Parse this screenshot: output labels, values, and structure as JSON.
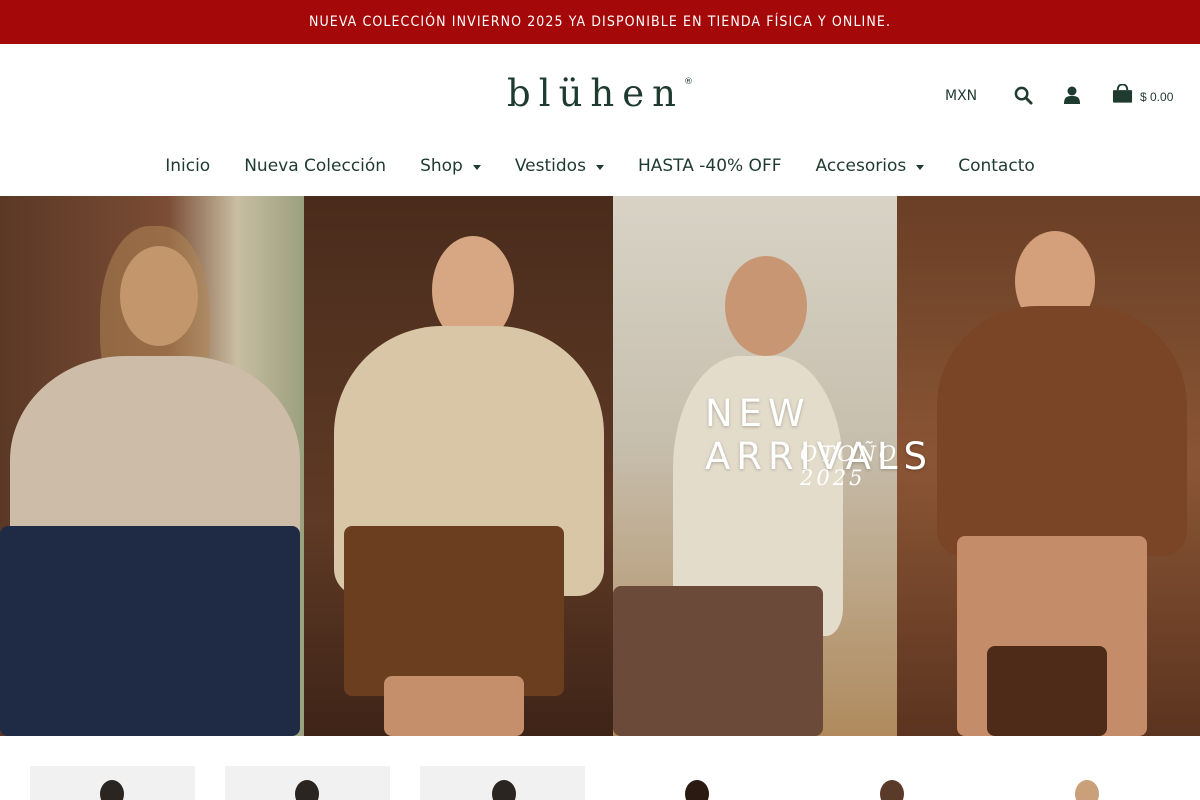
{
  "announcement": "NUEVA COLECCIÓN INVIERNO 2025 YA DISPONIBLE EN TIENDA FÍSICA Y ONLINE.",
  "brand": {
    "name": "blühen",
    "registered_mark": "®"
  },
  "header": {
    "currency": "MXN",
    "cart_total": "$ 0.00"
  },
  "nav": {
    "items": [
      {
        "label": "Inicio",
        "has_dropdown": false
      },
      {
        "label": "Nueva Colección",
        "has_dropdown": false
      },
      {
        "label": "Shop",
        "has_dropdown": true
      },
      {
        "label": "Vestidos",
        "has_dropdown": true
      },
      {
        "label": "HASTA -40% OFF",
        "has_dropdown": false
      },
      {
        "label": "Accesorios",
        "has_dropdown": true
      },
      {
        "label": "Contacto",
        "has_dropdown": false
      }
    ]
  },
  "hero": {
    "title": "NEW ARRIVALS",
    "subtitle": "OTOÑO 2025"
  },
  "icons": [
    "search-icon",
    "user-icon",
    "cart-icon",
    "chevron-down-icon"
  ],
  "colors": {
    "announcement_bg": "#a50808",
    "brand_green": "#1f3a2f",
    "text_on_banner": "#ffffff"
  }
}
